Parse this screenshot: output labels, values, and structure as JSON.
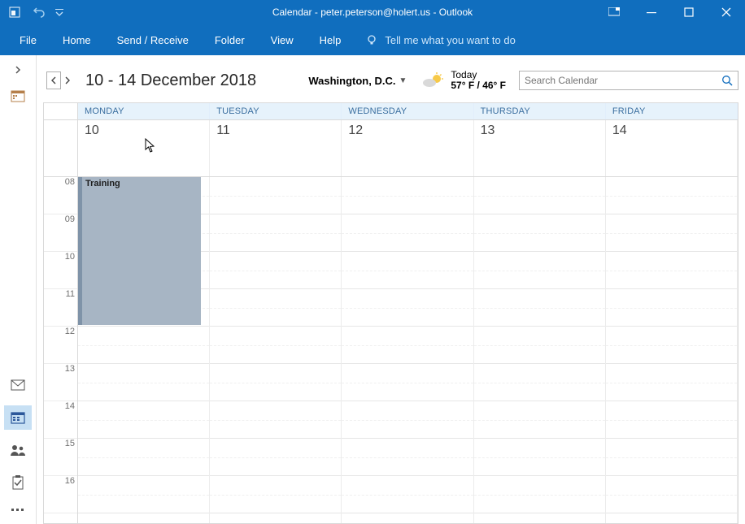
{
  "title": "Calendar - peter.peterson@holert.us - Outlook",
  "ribbon_tabs": {
    "file": "File",
    "home": "Home",
    "send_receive": "Send / Receive",
    "folder": "Folder",
    "view": "View",
    "help": "Help"
  },
  "tellme": "Tell me what you want to do",
  "date_range": "10 - 14 December 2018",
  "location": "Washington,  D.C.",
  "weather": {
    "today_label": "Today",
    "temps": "57° F / 46° F"
  },
  "search_placeholder": "Search Calendar",
  "day_headers": [
    "MONDAY",
    "TUESDAY",
    "WEDNESDAY",
    "THURSDAY",
    "FRIDAY"
  ],
  "day_numbers": [
    "10",
    "11",
    "12",
    "13",
    "14"
  ],
  "hours": [
    "08",
    "09",
    "10",
    "11",
    "12",
    "13",
    "14",
    "15",
    "16"
  ],
  "events": [
    {
      "title": "Training",
      "day_index": 0,
      "start_hour_index": 0,
      "end_hour_index": 4
    }
  ]
}
